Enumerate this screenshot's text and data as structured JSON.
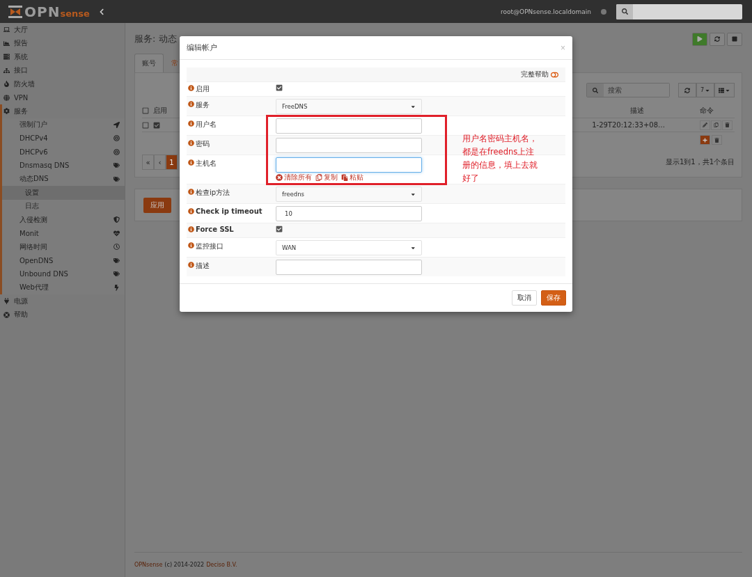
{
  "topbar": {
    "brand": "OPN",
    "brand_suffix": "sense",
    "user": "root@OPNsense.localdomain"
  },
  "sidebar": [
    {
      "label": "大厅",
      "selected": false
    },
    {
      "label": "报告",
      "selected": false
    },
    {
      "label": "系统",
      "selected": false
    },
    {
      "label": "接口",
      "selected": false
    },
    {
      "label": "防火墙",
      "selected": false
    },
    {
      "label": "VPN",
      "selected": false
    },
    {
      "label": "服务",
      "selected": false,
      "expanded": true,
      "children": [
        {
          "label": "强制门户",
          "selected": false
        },
        {
          "label": "DHCPv4",
          "selected": false
        },
        {
          "label": "DHCPv6",
          "selected": false
        },
        {
          "label": "Dnsmasq DNS",
          "selected": false
        },
        {
          "label": "动态DNS",
          "selected": false,
          "expanded": true,
          "children": [
            {
              "label": "设置",
              "selected": true
            },
            {
              "label": "日志",
              "selected": false
            }
          ]
        },
        {
          "label": "入侵检测",
          "selected": false
        },
        {
          "label": "Monit",
          "selected": false
        },
        {
          "label": "网络时间",
          "selected": false
        },
        {
          "label": "OpenDNS",
          "selected": false
        },
        {
          "label": "Unbound DNS",
          "selected": false
        },
        {
          "label": "Web代理",
          "selected": false
        }
      ]
    },
    {
      "label": "电源",
      "selected": false
    },
    {
      "label": "帮助",
      "selected": false
    }
  ],
  "page": {
    "title": "服务: 动态",
    "tabs": [
      {
        "label": "账号",
        "selected": true
      },
      {
        "label": "常",
        "selected": false
      }
    ],
    "grid": {
      "search_placeholder": "搜索",
      "all_selected": false,
      "page_size": "7",
      "columns": [
        "启用",
        "描述",
        "命令"
      ],
      "rows": [
        {
          "selected": false,
          "enabled": true,
          "column_2": "1-29T20:12:33+08…"
        }
      ],
      "pager": [
        {
          "label": "«",
          "selected": false
        },
        {
          "label": "‹",
          "selected": false
        },
        {
          "label": "1",
          "selected": true
        }
      ],
      "info": "显示1到1，共1个条目"
    },
    "apply": "应用",
    "footer": {
      "brand": "OPNsense",
      "text": "(c) 2014-2022",
      "company": "Deciso B.V."
    }
  },
  "dialog": {
    "title": "编辑帐户",
    "close": "×",
    "full_help": "完整帮助",
    "full_help_on": false,
    "fields": [
      {
        "kind": "checkbox",
        "label": "启用",
        "checked": true
      },
      {
        "kind": "select",
        "label": "服务",
        "value": "FreeDNS"
      },
      {
        "kind": "text",
        "label": "用户名"
      },
      {
        "kind": "text",
        "label": "密码"
      },
      {
        "kind": "text",
        "label": "主机名",
        "focused": true,
        "actions": [
          "清除所有",
          "复制",
          "粘贴"
        ]
      },
      {
        "kind": "select",
        "label": "检查ip方法",
        "value": "freedns"
      },
      {
        "kind": "text",
        "label": "Check ip timeout",
        "value": "10"
      },
      {
        "kind": "checkbox",
        "label": "Force SSL",
        "checked": true
      },
      {
        "kind": "select",
        "label": "监控接口",
        "value": "WAN"
      },
      {
        "kind": "text",
        "label": "描述"
      }
    ],
    "buttons": [
      {
        "kind": "default",
        "label": "取消"
      },
      {
        "kind": "primary",
        "label": "保存"
      }
    ]
  },
  "annotation": {
    "text": "用户名密码主机名，都是在freedns上注册的信息，填上去就好了"
  }
}
